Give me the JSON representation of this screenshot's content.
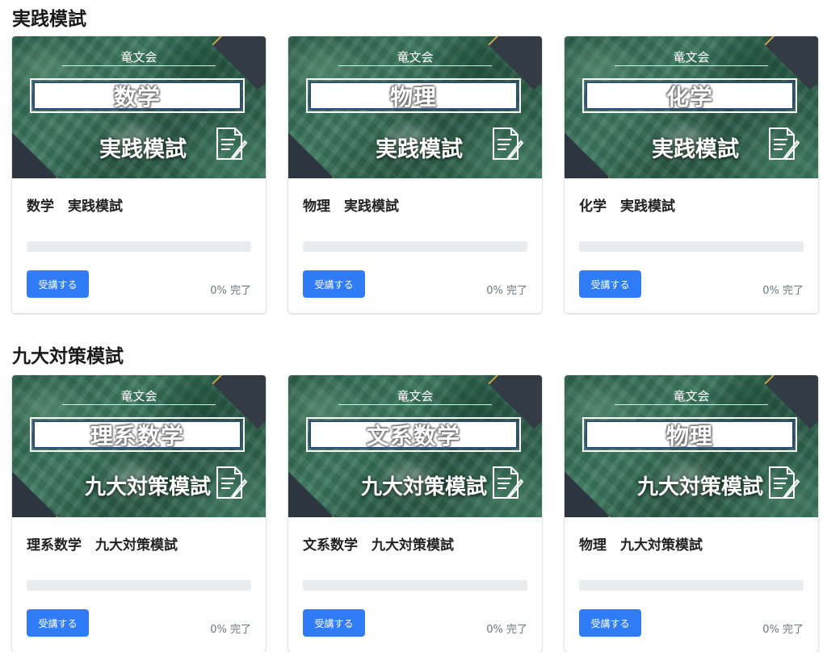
{
  "sections": [
    {
      "title": "実践模試",
      "courses": [
        {
          "brand": "竜文会",
          "subject": "数学",
          "exam": "実践模試",
          "title": "数学　実践模試",
          "button": "受講する",
          "progress": 0,
          "progress_text": "0% 完了"
        },
        {
          "brand": "竜文会",
          "subject": "物理",
          "exam": "実践模試",
          "title": "物理　実践模試",
          "button": "受講する",
          "progress": 0,
          "progress_text": "0% 完了"
        },
        {
          "brand": "竜文会",
          "subject": "化学",
          "exam": "実践模試",
          "title": "化学　実践模試",
          "button": "受講する",
          "progress": 0,
          "progress_text": "0% 完了"
        }
      ]
    },
    {
      "title": "九大対策模試",
      "courses": [
        {
          "brand": "竜文会",
          "subject": "理系数学",
          "exam": "九大対策模試",
          "title": "理系数学　九大対策模試",
          "button": "受講する",
          "progress": 0,
          "progress_text": "0% 完了"
        },
        {
          "brand": "竜文会",
          "subject": "文系数学",
          "exam": "九大対策模試",
          "title": "文系数学　九大対策模試",
          "button": "受講する",
          "progress": 0,
          "progress_text": "0% 完了"
        },
        {
          "brand": "竜文会",
          "subject": "物理",
          "exam": "九大対策模試",
          "title": "物理　九大対策模試",
          "button": "受講する",
          "progress": 0,
          "progress_text": "0% 完了"
        }
      ]
    }
  ],
  "colors": {
    "accent": "#2f7cf6",
    "progress_track": "#e9ecef",
    "thumbnail_green": "#2c5f4b",
    "subject_border": "#2c4a86"
  }
}
